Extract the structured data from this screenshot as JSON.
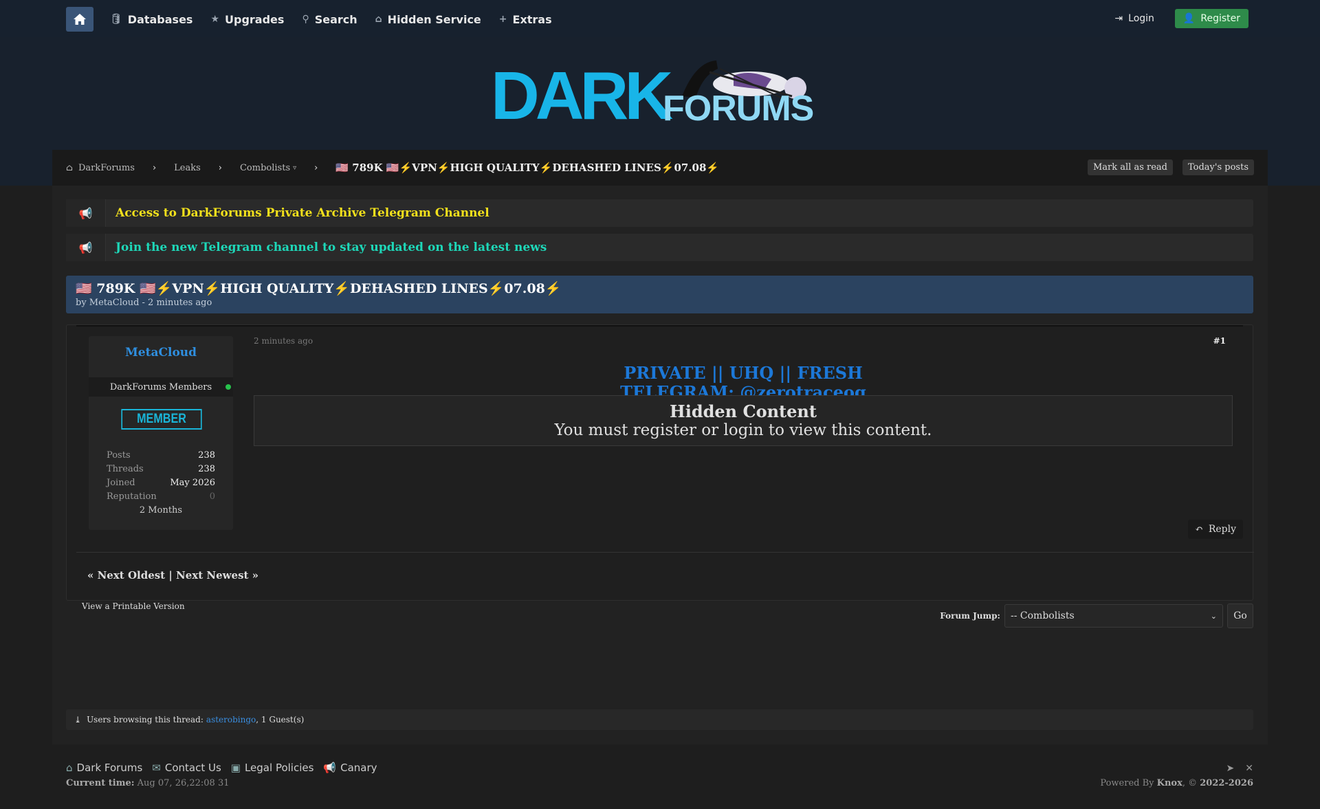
{
  "nav": {
    "items": [
      {
        "icon": "database-icon",
        "label": "Databases"
      },
      {
        "icon": "star-icon",
        "label": "Upgrades"
      },
      {
        "icon": "search-icon",
        "label": "Search"
      },
      {
        "icon": "building-icon",
        "label": "Hidden Service"
      },
      {
        "icon": "plus-icon",
        "label": "Extras"
      }
    ],
    "login": "Login",
    "register": "Register"
  },
  "logo": {
    "dark": "DARK",
    "forums": "FORUMS"
  },
  "breadcrumb": {
    "home": "DarkForums",
    "leaks": "Leaks",
    "combolists": "Combolists",
    "current": "🇺🇸 789K 🇺🇸⚡VPN⚡HIGH QUALITY⚡DEHASHED LINES⚡07.08⚡",
    "mark_read": "Mark all as read",
    "todays_posts": "Today's posts"
  },
  "announcements": [
    {
      "text": "Access to DarkForums Private Archive Telegram Channel",
      "color": "#f2e01c"
    },
    {
      "text": "Join the new Telegram channel to stay updated on the latest news",
      "color": "#1ed7b8"
    }
  ],
  "thread": {
    "title": "🇺🇸 789K 🇺🇸⚡VPN⚡HIGH QUALITY⚡DEHASHED LINES⚡07.08⚡",
    "byline": "by MetaCloud - 2 minutes ago"
  },
  "author": {
    "name": "MetaCloud",
    "group": "DarkForums Members",
    "badge": "MEMBER",
    "stats": [
      {
        "k": "Posts",
        "v": "238"
      },
      {
        "k": "Threads",
        "v": "238"
      },
      {
        "k": "Joined",
        "v": "May 2026"
      },
      {
        "k": "Reputation",
        "v": "0"
      }
    ],
    "months": "2 Months"
  },
  "post": {
    "date": "2 minutes ago",
    "number": "#1",
    "line1": "PRIVATE || UHQ || FRESH",
    "line2": "TELEGRAM: @zerotraceog",
    "hidden_title": "Hidden Content",
    "hidden_msg": "You must register or login to view this content.",
    "reply": "Reply",
    "pager": "« Next Oldest | Next Newest »"
  },
  "printable": "View a Printable Version",
  "forum_jump": {
    "label": "Forum Jump:",
    "selected": "-- Combolists",
    "go": "Go"
  },
  "browsing": {
    "prefix": "Users browsing this thread:",
    "user": "asterobingo",
    "suffix": ", 1 Guest(s)"
  },
  "footer": {
    "links": [
      {
        "icon": "home-icon",
        "label": "Dark Forums"
      },
      {
        "icon": "mail-icon",
        "label": "Contact Us"
      },
      {
        "icon": "briefcase-icon",
        "label": "Legal Policies"
      },
      {
        "icon": "megaphone-icon",
        "label": "Canary"
      }
    ],
    "time_label": "Current time:",
    "time_value": "Aug 07, 26,22:08 31",
    "powered_prefix": "Powered By",
    "powered_name": "Knox",
    "powered_sep": ", ©",
    "powered_years": "2022-2026"
  }
}
